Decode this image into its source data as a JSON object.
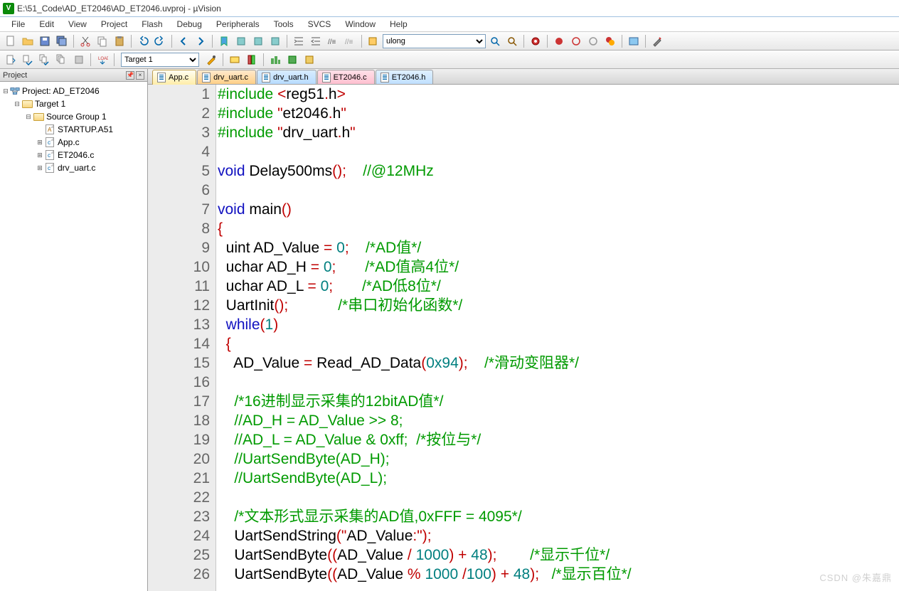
{
  "title": "E:\\51_Code\\AD_ET2046\\AD_ET2046.uvproj - µVision",
  "menu": [
    "File",
    "Edit",
    "View",
    "Project",
    "Flash",
    "Debug",
    "Peripherals",
    "Tools",
    "SVCS",
    "Window",
    "Help"
  ],
  "toolbar_combo": "ulong",
  "target_combo": "Target 1",
  "project_panel_title": "Project",
  "tree": {
    "root": "Project: AD_ET2046",
    "target": "Target 1",
    "group": "Source Group 1",
    "files": [
      "STARTUP.A51",
      "App.c",
      "ET2046.c",
      "drv_uart.c"
    ]
  },
  "tabs": [
    {
      "label": "App.c",
      "cls": "active"
    },
    {
      "label": "drv_uart.c",
      "cls": "orange"
    },
    {
      "label": "drv_uart.h",
      "cls": "blue"
    },
    {
      "label": "ET2046.c",
      "cls": "pink"
    },
    {
      "label": "ET2046.h",
      "cls": "lblue"
    }
  ],
  "code": [
    {
      "n": 1,
      "h": "<span class='dir'>#include</span> <span class='inc'>&lt;</span><span class='fn'>reg51</span><span class='op'>.</span><span class='fn'>h</span><span class='inc'>&gt;</span>"
    },
    {
      "n": 2,
      "h": "<span class='dir'>#include</span> <span class='inc'>\"</span><span class='fn'>et2046</span><span class='op'>.</span><span class='fn'>h</span><span class='inc'>\"</span>"
    },
    {
      "n": 3,
      "h": "<span class='dir'>#include</span> <span class='inc'>\"</span><span class='fn'>drv_uart</span><span class='op'>.</span><span class='fn'>h</span><span class='inc'>\"</span>"
    },
    {
      "n": 4,
      "h": ""
    },
    {
      "n": 5,
      "h": "<span class='kw'>void</span> Delay500ms<span class='op'>();</span>    <span class='cmt'>//@12MHz</span>"
    },
    {
      "n": 6,
      "h": ""
    },
    {
      "n": 7,
      "h": "<span class='kw'>void</span> main<span class='op'>()</span>"
    },
    {
      "n": 8,
      "h": "<span class='op'>{</span>"
    },
    {
      "n": 9,
      "h": "  uint AD_Value <span class='op'>=</span> <span class='num'>0</span><span class='op'>;</span>    <span class='cmt'>/*AD值*/</span>"
    },
    {
      "n": 10,
      "h": "  uchar AD_H <span class='op'>=</span> <span class='num'>0</span><span class='op'>;</span>       <span class='cmt'>/*AD值高4位*/</span>"
    },
    {
      "n": 11,
      "h": "  uchar AD_L <span class='op'>=</span> <span class='num'>0</span><span class='op'>;</span>       <span class='cmt'>/*AD低8位*/</span>"
    },
    {
      "n": 12,
      "h": "  UartInit<span class='op'>();</span>            <span class='cmt'>/*串口初始化函数*/</span>"
    },
    {
      "n": 13,
      "h": "  <span class='kw'>while</span><span class='op'>(</span><span class='num'>1</span><span class='op'>)</span>"
    },
    {
      "n": 14,
      "h": "  <span class='op'>{</span>"
    },
    {
      "n": 15,
      "h": "    AD_Value <span class='op'>=</span> Read_AD_Data<span class='op'>(</span><span class='num'>0x94</span><span class='op'>);</span>    <span class='cmt'>/*滑动变阻器*/</span>"
    },
    {
      "n": 16,
      "h": ""
    },
    {
      "n": 17,
      "h": "    <span class='cmt'>/*16进制显示采集的12bitAD值*/</span>"
    },
    {
      "n": 18,
      "h": "    <span class='cmt'>//AD_H = AD_Value &gt;&gt; 8;</span>"
    },
    {
      "n": 19,
      "h": "    <span class='cmt'>//AD_L = AD_Value &amp; 0xff;  /*按位与*/</span>"
    },
    {
      "n": 20,
      "h": "    <span class='cmt'>//UartSendByte(AD_H);</span>"
    },
    {
      "n": 21,
      "h": "    <span class='cmt'>//UartSendByte(AD_L);</span>"
    },
    {
      "n": 22,
      "h": ""
    },
    {
      "n": 23,
      "h": "    <span class='cmt'>/*文本形式显示采集的AD值,0xFFF = 4095*/</span>"
    },
    {
      "n": 24,
      "h": "    UartSendString<span class='op'>(</span><span class='inc'>\"</span>AD_Value<span class='op'>:</span><span class='inc'>\"</span><span class='op'>);</span>"
    },
    {
      "n": 25,
      "h": "    UartSendByte<span class='op'>((</span>AD_Value <span class='op'>/</span> <span class='num'>1000</span><span class='op'>)</span> <span class='op'>+</span> <span class='num'>48</span><span class='op'>);</span>        <span class='cmt'>/*显示千位*/</span>"
    },
    {
      "n": 26,
      "h": "    UartSendByte<span class='op'>((</span>AD_Value <span class='op'>%</span> <span class='num'>1000</span> <span class='op'>/</span><span class='num'>100</span><span class='op'>)</span> <span class='op'>+</span> <span class='num'>48</span><span class='op'>);</span>   <span class='cmt'>/*显示百位*/</span>"
    }
  ],
  "watermark": "CSDN @朱嘉鼎"
}
